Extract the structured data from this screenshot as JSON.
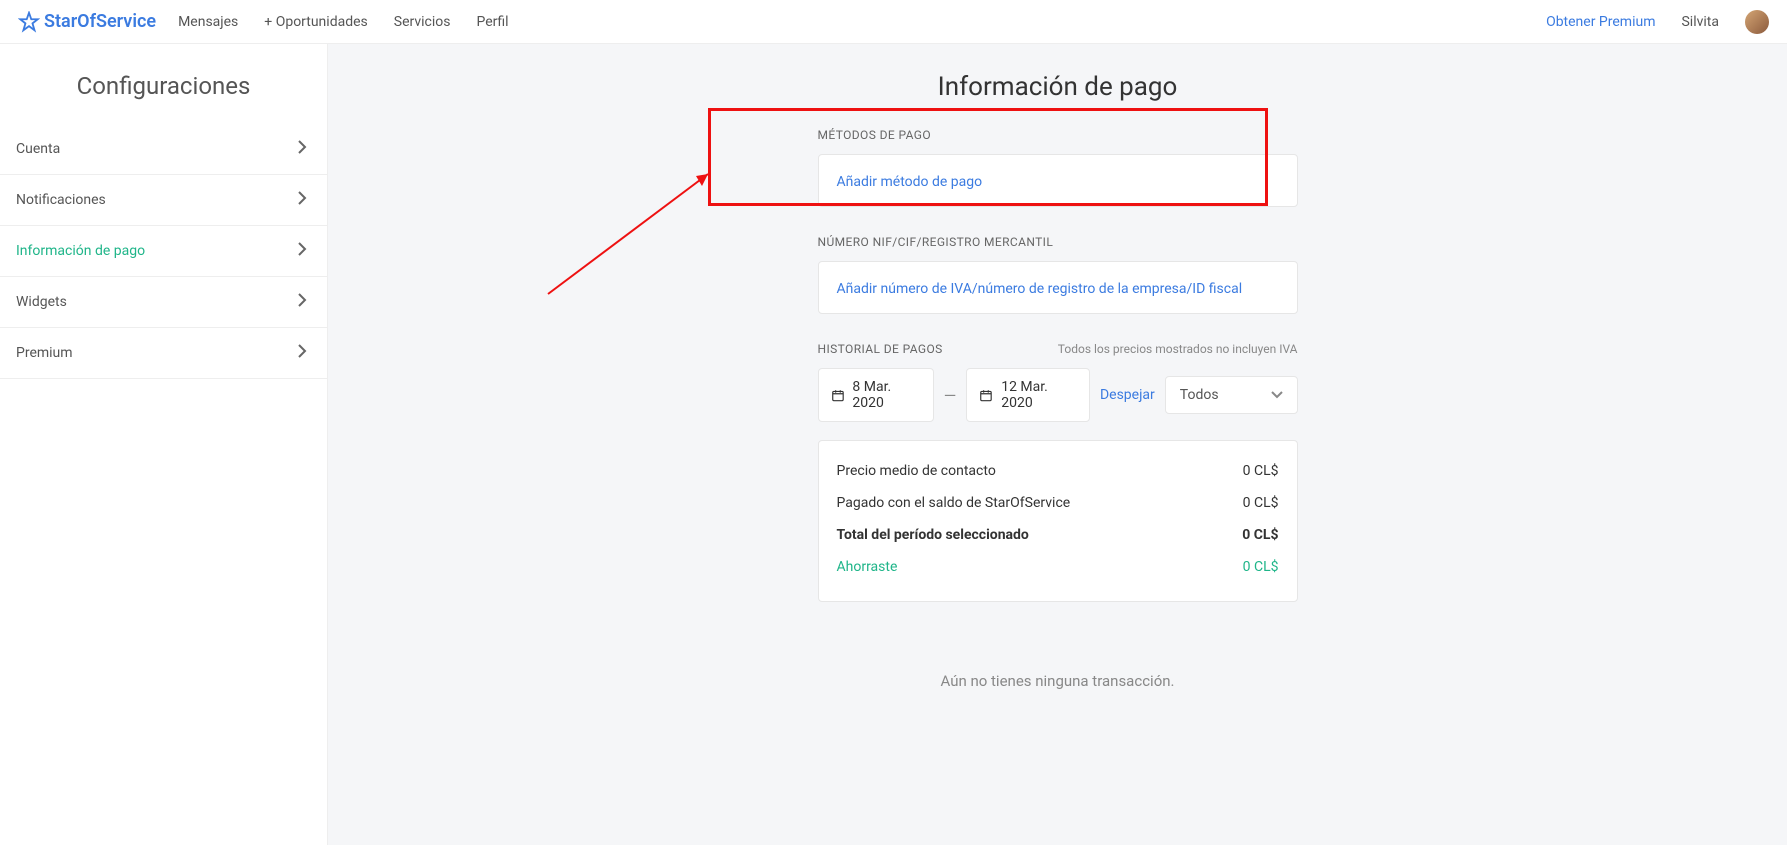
{
  "brand": "StarOfService",
  "nav": {
    "mensajes": "Mensajes",
    "oportunidades": "+ Oportunidades",
    "servicios": "Servicios",
    "perfil": "Perfil",
    "premium": "Obtener Premium",
    "user": "Silvita"
  },
  "sidebar": {
    "title": "Configuraciones",
    "items": [
      {
        "label": "Cuenta"
      },
      {
        "label": "Notificaciones"
      },
      {
        "label": "Información de pago"
      },
      {
        "label": "Widgets"
      },
      {
        "label": "Premium"
      }
    ]
  },
  "page": {
    "title": "Información de pago",
    "sections": {
      "paymentMethods": {
        "label": "MÉTODOS DE PAGO",
        "addLink": "Añadir método de pago"
      },
      "vat": {
        "label": "NÚMERO NIF/CIF/REGISTRO MERCANTIL",
        "addLink": "Añadir número de IVA/número de registro de la empresa/ID fiscal"
      },
      "history": {
        "label": "HISTORIAL DE PAGOS",
        "note": "Todos los precios mostrados no incluyen IVA",
        "date_from": "8 Mar. 2020",
        "date_to": "12 Mar. 2020",
        "clear": "Despejar",
        "filter_selected": "Todos",
        "rows": [
          {
            "label": "Precio medio de contacto",
            "value": "0 CL$"
          },
          {
            "label": "Pagado con el saldo de StarOfService",
            "value": "0 CL$"
          },
          {
            "label": "Total del período seleccionado",
            "value": "0 CL$"
          },
          {
            "label": "Ahorraste",
            "value": "0 CL$"
          }
        ],
        "empty": "Aún no tienes ninguna transacción."
      }
    }
  }
}
